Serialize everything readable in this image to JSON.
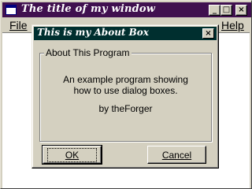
{
  "main_window": {
    "title": "The title of my window",
    "controls": {
      "minimize": "_",
      "maximize": "□",
      "close": "×"
    },
    "menu": {
      "file": "File",
      "help": "Help"
    }
  },
  "dialog": {
    "title": "This is my About Box",
    "close": "×",
    "group_label": "About This Program",
    "description_line1": "An example program showing",
    "description_line2": "how to use dialog boxes.",
    "author": "by theForger",
    "ok_label": "OK",
    "cancel_label": "Cancel"
  },
  "icons": {
    "app": "window-app-icon",
    "close": "close-icon",
    "minimize": "minimize-icon",
    "maximize": "maximize-icon"
  },
  "colors": {
    "main_titlebar": "#40104f",
    "dialog_titlebar": "#002f2f",
    "face": "#d4d0c0"
  }
}
